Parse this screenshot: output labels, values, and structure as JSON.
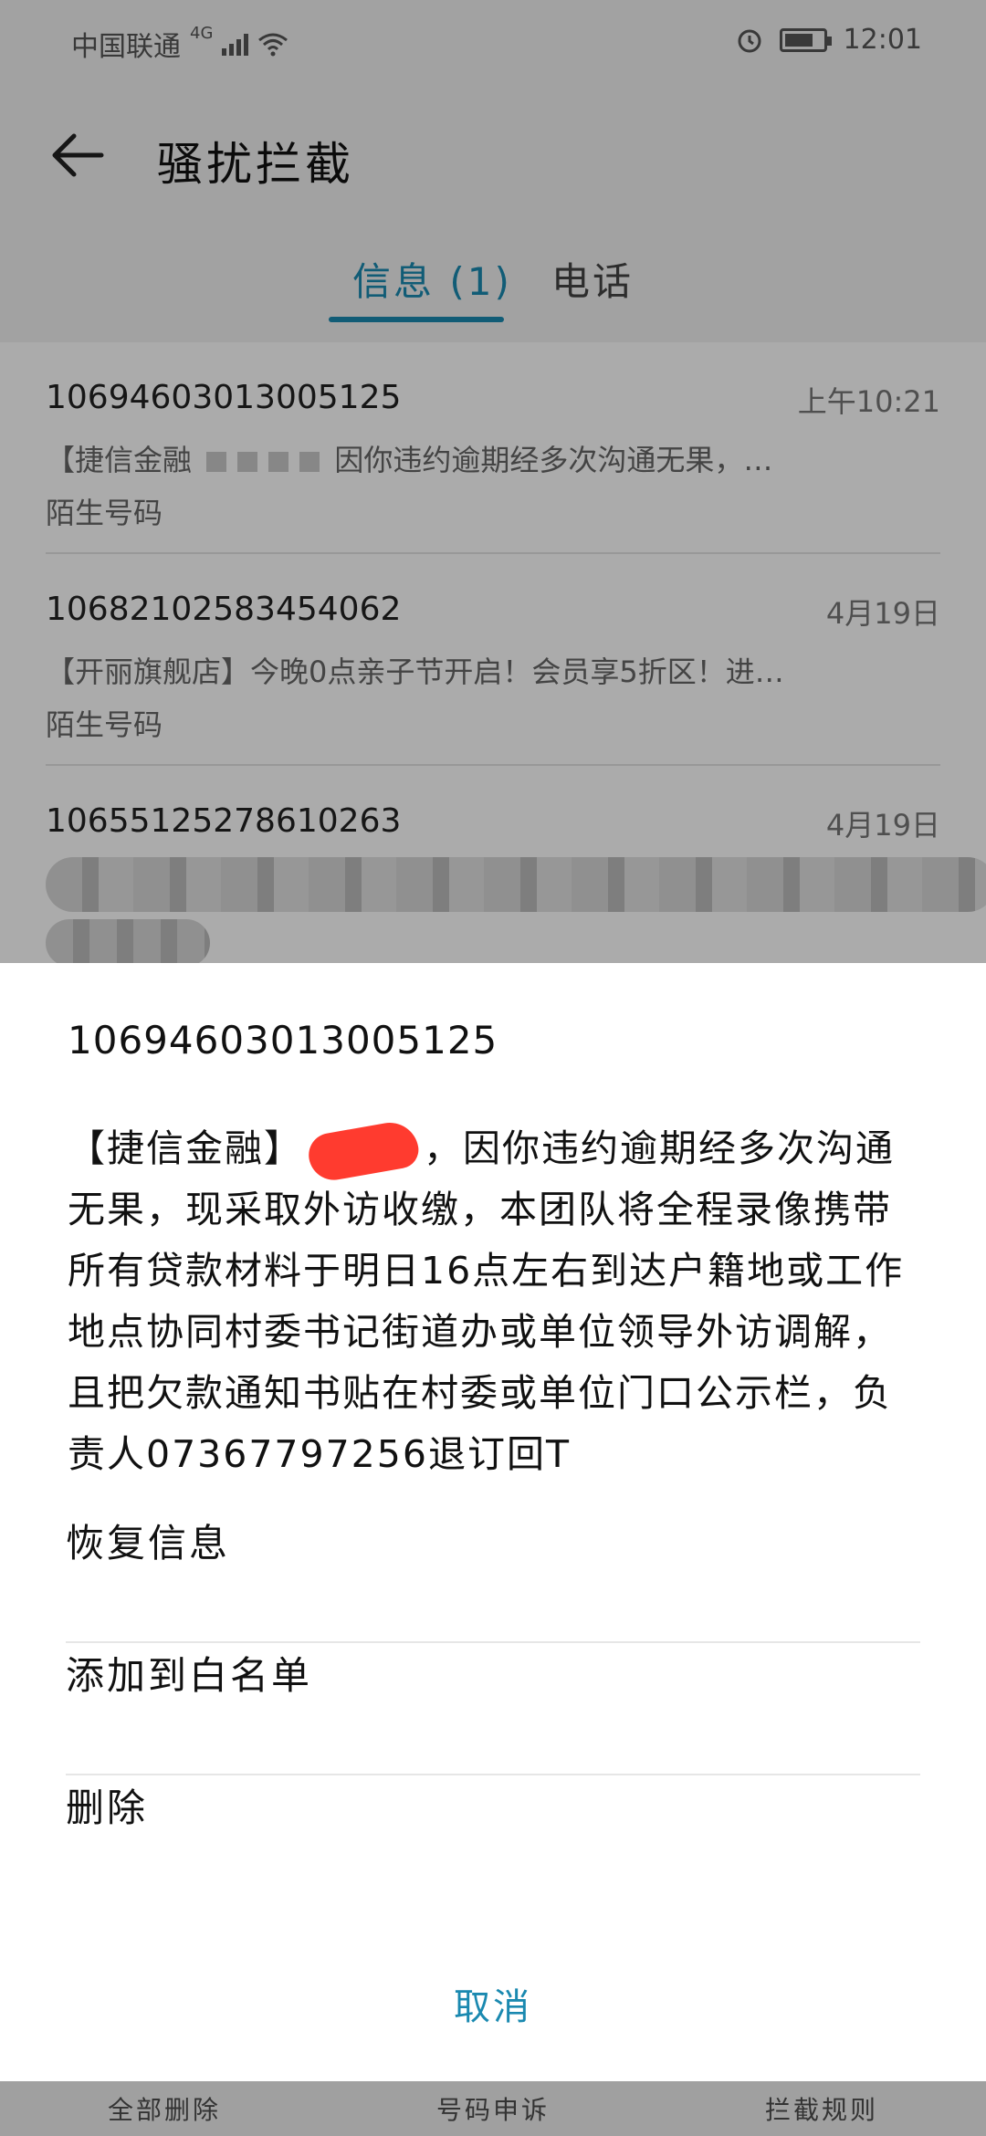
{
  "status_bar": {
    "carrier": "中国联通",
    "network": "4G",
    "time": "12:01"
  },
  "header": {
    "title": "骚扰拦截"
  },
  "tabs": [
    {
      "label": "信息 (1)",
      "active": true
    },
    {
      "label": "电话",
      "active": false
    }
  ],
  "messages": [
    {
      "number": "10694603013005125",
      "time": "上午10:21",
      "preview_start": "【捷信金融",
      "preview_end": "因你违约逾期经多次沟通无果，…",
      "sub": "陌生号码"
    },
    {
      "number": "10682102583454062",
      "time": "4月19日",
      "preview": "【开丽旗舰店】今晚0点亲子节开启！会员享5折区！进…",
      "sub": "陌生号码"
    },
    {
      "number": "10655125278610263",
      "time": "4月19日"
    }
  ],
  "sheet": {
    "number": "10694603013005125",
    "body_prefix": "【捷信金融】",
    "body_text": "，因你违约逾期经多次沟通无果，现采取外访收缴，本团队将全程录像携带所有贷款材料于明日16点左右到达户籍地或工作地点协同村委书记街道办或单位领导外访调解，且把欠款通知书贴在村委或单位门口公示栏，负责人07367797256退订回T",
    "actions": {
      "restore": "恢复信息",
      "whitelist": "添加到白名单",
      "delete": "删除"
    },
    "cancel": "取消"
  },
  "toolbar": {
    "delete_all": "全部删除",
    "appeal": "号码申诉",
    "rules": "拦截规则"
  },
  "colors": {
    "accent": "#1a89b0",
    "redaction": "#ff3b2f"
  }
}
